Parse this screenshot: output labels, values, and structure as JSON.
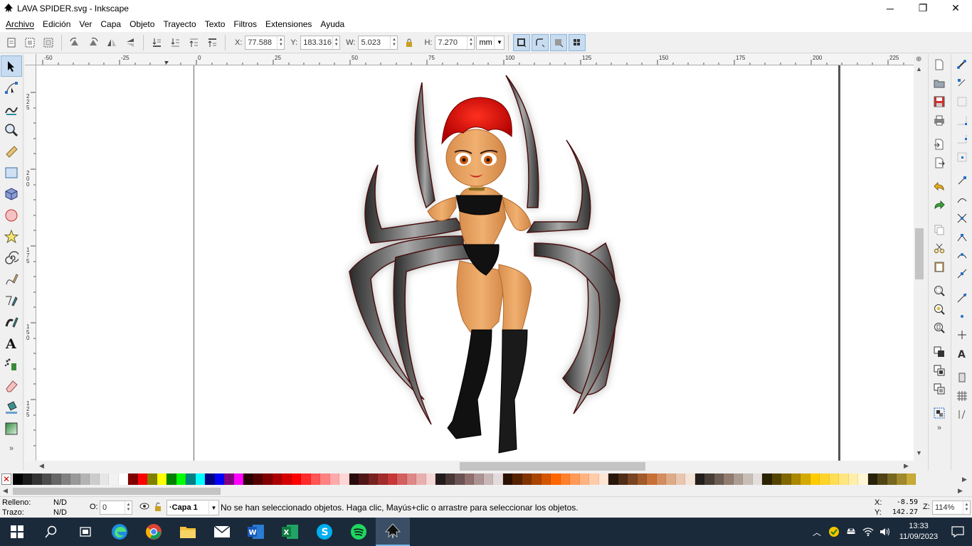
{
  "window": {
    "title": "LAVA SPIDER.svg - Inkscape",
    "minimize_icon": "minimize-icon",
    "maximize_icon": "restore-icon",
    "close_icon": "close-icon"
  },
  "menu": [
    "Archivo",
    "Edición",
    "Ver",
    "Capa",
    "Objeto",
    "Trayecto",
    "Texto",
    "Filtros",
    "Extensiones",
    "Ayuda"
  ],
  "controls": {
    "x_label": "X:",
    "x_value": "77.588",
    "y_label": "Y:",
    "y_value": "183.316",
    "w_label": "W:",
    "w_value": "5.023",
    "h_label": "H:",
    "h_value": "7.270",
    "unit": "mm"
  },
  "ruler": {
    "h_ticks": [
      "-50",
      "-25",
      "0",
      "25",
      "50",
      "75",
      "100",
      "125",
      "150",
      "175",
      "200",
      "225"
    ],
    "v_ticks": [
      "225",
      "200",
      "175",
      "150",
      "125"
    ]
  },
  "status": {
    "fill_label": "Relleno:",
    "fill_value": "N/D",
    "stroke_label": "Trazo:",
    "stroke_value": "N/D",
    "opacity_label": "O:",
    "opacity_value": "0",
    "layer": "·Capa 1",
    "message": "No se han seleccionado objetos. Haga clic, Mayús+clic o arrastre para seleccionar los objetos.",
    "cursor_x_label": "X:",
    "cursor_x": "-8.59",
    "cursor_y_label": "Y:",
    "cursor_y": "142.27",
    "zoom_label": "Z:",
    "zoom": "114%"
  },
  "taskbar": {
    "time": "13:33",
    "date": "11/09/2023",
    "apps": [
      "start-icon",
      "search-icon",
      "task-view-icon",
      "edge-icon",
      "chrome-icon",
      "file-explorer-icon",
      "mail-icon",
      "word-icon",
      "excel-icon",
      "skype-icon",
      "spotify-icon",
      "inkscape-icon"
    ]
  },
  "palette_colors": [
    "#000000",
    "#1a1a1a",
    "#333333",
    "#4d4d4d",
    "#666666",
    "#808080",
    "#999999",
    "#b3b3b3",
    "#cccccc",
    "#e6e6e6",
    "#f2f2f2",
    "#ffffff",
    "#800000",
    "#ff0000",
    "#808000",
    "#ffff00",
    "#008000",
    "#00ff00",
    "#008080",
    "#00ffff",
    "#000080",
    "#0000ff",
    "#800080",
    "#ff00ff",
    "#2b0000",
    "#550000",
    "#800000",
    "#aa0000",
    "#d40000",
    "#ff0000",
    "#ff2a2a",
    "#ff5555",
    "#ff8080",
    "#ffaaaa",
    "#ffd5d5",
    "#280b0b",
    "#501616",
    "#782121",
    "#a02c2c",
    "#c83737",
    "#d35f5f",
    "#de8787",
    "#e9afaf",
    "#f4d7d7",
    "#241c1c",
    "#483737",
    "#6c5353",
    "#916f6f",
    "#ac9393",
    "#c8b7b7",
    "#e3dbdb",
    "#2b1100",
    "#552200",
    "#803300",
    "#aa4400",
    "#d45500",
    "#ff6600",
    "#ff7f2a",
    "#ff9955",
    "#ffb380",
    "#ffccaa",
    "#ffe6d5",
    "#28170b",
    "#502d16",
    "#784421",
    "#a05a2c",
    "#c87137",
    "#d38d5f",
    "#deaa87",
    "#e9c6af",
    "#f4e3d7",
    "#241f1c",
    "#483e37",
    "#6c5d53",
    "#917c6f",
    "#ac9d93",
    "#c8beb7",
    "#e3dedb",
    "#2b2200",
    "#554400",
    "#806600",
    "#aa8800",
    "#d4aa00",
    "#ffcc00",
    "#ffd42a",
    "#ffdd55",
    "#ffe680",
    "#ffeeaa",
    "#fff6d5",
    "#28220b",
    "#504416",
    "#786721",
    "#a0892c",
    "#c8ab37"
  ]
}
